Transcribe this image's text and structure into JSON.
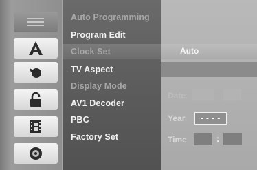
{
  "menu": {
    "items": [
      {
        "label": "Auto Programming",
        "state": "dim"
      },
      {
        "label": "Program Edit",
        "state": "normal"
      },
      {
        "label": "Clock Set",
        "state": "selected"
      },
      {
        "label": "TV Aspect",
        "state": "normal"
      },
      {
        "label": "Display Mode",
        "state": "dim"
      },
      {
        "label": "AV1 Decoder",
        "state": "normal"
      },
      {
        "label": "PBC",
        "state": "normal"
      },
      {
        "label": "Factory Set",
        "state": "normal"
      }
    ]
  },
  "sidebar": {
    "icons": [
      {
        "name": "setup-icon",
        "active": true
      },
      {
        "name": "a-icon",
        "active": false
      },
      {
        "name": "audio-icon",
        "active": false
      },
      {
        "name": "lock-icon",
        "active": false
      },
      {
        "name": "film-icon",
        "active": false
      },
      {
        "name": "disc-icon",
        "active": false
      }
    ]
  },
  "clock": {
    "mode_value": "Auto",
    "date_label": "Date",
    "year_label": "Year",
    "year_value": "----",
    "time_label": "Time",
    "time_separator": ":"
  },
  "colors": {
    "menu_bg": "#5e5e5e",
    "highlight": "#b3b3b3",
    "panel_bg": "#b1b1b1"
  }
}
